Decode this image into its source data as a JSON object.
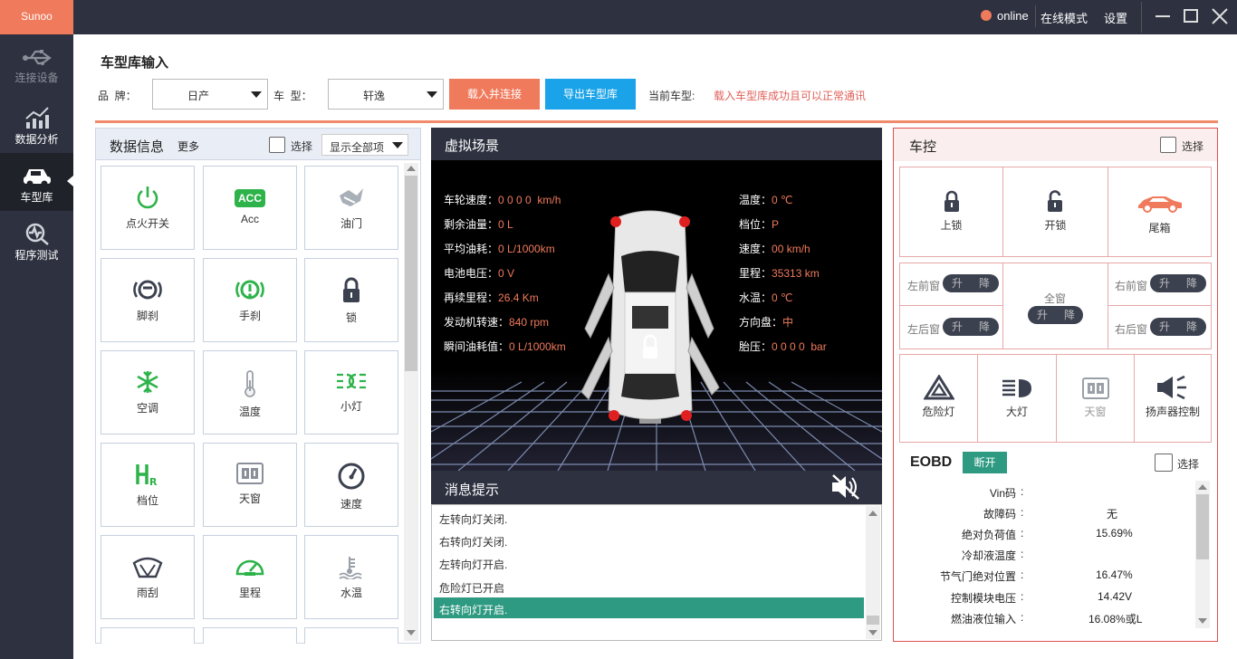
{
  "app": {
    "logo": "Sunoo"
  },
  "titlebar": {
    "status": "online",
    "mode": "在线模式",
    "settings": "设置",
    "minimize_icon": "minimize-icon",
    "maximize_icon": "maximize-icon",
    "close_icon": "close-icon",
    "status_color": "#f07a5c"
  },
  "sidebar": {
    "items": [
      {
        "label": "连接设备",
        "icon": "usb-icon"
      },
      {
        "label": "数据分析",
        "icon": "chart-icon"
      },
      {
        "label": "车型库",
        "icon": "car-icon",
        "active": true
      },
      {
        "label": "程序测试",
        "icon": "test-icon"
      }
    ]
  },
  "header": {
    "title": "车型库输入",
    "brand_label": "品  牌：",
    "brand_value": "日产",
    "model_label": "车  型：",
    "model_value": "轩逸",
    "load_button": "载入并连接",
    "export_button": "导出车型库",
    "current_label": "当前车型:",
    "current_msg": "载入车型库成功且可以正常通讯"
  },
  "data_panel": {
    "title": "数据信息",
    "more": "更多",
    "select_label": "选择",
    "filter_value": "显示全部项",
    "tiles": [
      {
        "label": "点火开关",
        "icon": "power-icon"
      },
      {
        "label": "Acc",
        "icon": "acc-icon",
        "badge": "ACC"
      },
      {
        "label": "油门",
        "icon": "throttle-icon"
      },
      {
        "label": "脚刹",
        "icon": "foot-brake-icon"
      },
      {
        "label": "手刹",
        "icon": "hand-brake-icon"
      },
      {
        "label": "锁",
        "icon": "lock-icon"
      },
      {
        "label": "空调",
        "icon": "snowflake-icon"
      },
      {
        "label": "温度",
        "icon": "thermometer-icon"
      },
      {
        "label": "小灯",
        "icon": "side-light-icon"
      },
      {
        "label": "档位",
        "icon": "gear-shift-icon"
      },
      {
        "label": "天窗",
        "icon": "sunroof-icon"
      },
      {
        "label": "速度",
        "icon": "speedometer-icon"
      },
      {
        "label": "雨刮",
        "icon": "wiper-icon"
      },
      {
        "label": "里程",
        "icon": "odometer-icon"
      },
      {
        "label": "水温",
        "icon": "coolant-icon"
      }
    ]
  },
  "scene": {
    "title": "虚拟场景",
    "left": [
      {
        "label": "车轮速度：",
        "value": "0 0 0 0  km/h"
      },
      {
        "label": "剩余油量：",
        "value": "0 L"
      },
      {
        "label": "平均油耗：",
        "value": "0 L/1000km"
      },
      {
        "label": "电池电压：",
        "value": "0 V"
      },
      {
        "label": "再续里程：",
        "value": "26.4 Km"
      },
      {
        "label": "发动机转速：",
        "value": "840 rpm"
      },
      {
        "label": "瞬间油耗值：",
        "value": "0 L/1000km"
      }
    ],
    "right": [
      {
        "label": "温度：",
        "value": "0 ℃"
      },
      {
        "label": "档位：",
        "value": "P"
      },
      {
        "label": "速度：",
        "value": "00 km/h"
      },
      {
        "label": "里程：",
        "value": "35313 km"
      },
      {
        "label": "水温：",
        "value": "0 ℃"
      },
      {
        "label": "方向盘：",
        "value": "中"
      },
      {
        "label": "胎压：",
        "value": "0 0 0 0  bar"
      }
    ]
  },
  "messages": {
    "title": "消息提示",
    "items": [
      "左转向灯关闭.",
      "右转向灯关闭.",
      "左转向灯开启.",
      "危险灯已开启",
      "右转向灯开启."
    ],
    "selected_index": 4
  },
  "control": {
    "title": "车控",
    "select_label": "选择",
    "lock": "上锁",
    "unlock": "开锁",
    "trunk": "尾箱",
    "windows": {
      "front_left": "左前窗",
      "rear_left": "左后窗",
      "all": "全窗",
      "front_right": "右前窗",
      "rear_right": "右后窗",
      "up": "升",
      "down": "降"
    },
    "hazard": "危险灯",
    "headlight": "大灯",
    "sunroof": "天窗",
    "speaker": "扬声器控制"
  },
  "eobd": {
    "title": "EOBD",
    "disconnect": "断开",
    "select_label": "选择",
    "rows": [
      {
        "label": "Vin码",
        "value": ""
      },
      {
        "label": "故障码",
        "value": "无"
      },
      {
        "label": "绝对负荷值",
        "value": "15.69%"
      },
      {
        "label": "冷却液温度",
        "value": ""
      },
      {
        "label": "节气门绝对位置",
        "value": "16.47%"
      },
      {
        "label": "控制模块电压",
        "value": "14.42V"
      },
      {
        "label": "燃油液位输入",
        "value": "16.08%或L"
      }
    ]
  },
  "colors": {
    "accent_orange": "#f07a5c",
    "accent_blue": "#1aa3e8",
    "green": "#2db34a",
    "teal": "#2e9a82",
    "dark": "#2e3240"
  }
}
